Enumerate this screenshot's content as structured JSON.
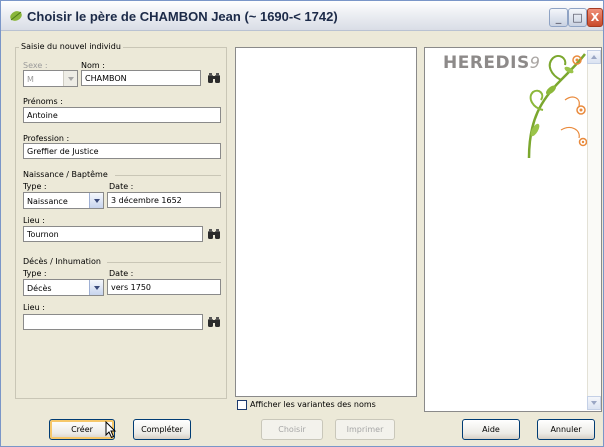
{
  "window": {
    "title": "Choisir le père de CHAMBON Jean (~ 1690-< 1742)",
    "minimize_glyph": "_",
    "maximize_glyph": "□",
    "close_glyph": "X"
  },
  "form": {
    "group_title": "Saisie du nouvel individu",
    "sexe_label": "Sexe :",
    "sexe_value": "M",
    "nom_label": "Nom :",
    "nom_value": "CHAMBON",
    "prenoms_label": "Prénoms :",
    "prenoms_value": "Antoine",
    "profession_label": "Profession :",
    "profession_value": "Greffier de Justice",
    "naissance": {
      "section_title": "Naissance / Baptême",
      "type_label": "Type :",
      "type_value": "Naissance",
      "date_label": "Date :",
      "date_value": "3 décembre 1652",
      "lieu_label": "Lieu :",
      "lieu_value": "Tournon"
    },
    "deces": {
      "section_title": "Décès / Inhumation",
      "type_label": "Type :",
      "type_value": "Décès",
      "date_label": "Date :",
      "date_value": "vers 1750",
      "lieu_label": "Lieu :",
      "lieu_value": ""
    }
  },
  "middle": {
    "checkbox_label": "Afficher les variantes des noms",
    "checkbox_checked": false
  },
  "brand": {
    "logo_text": "HEREDIS",
    "logo_num": "9",
    "accent_green": "#7ba72e",
    "accent_orange": "#e98a3c"
  },
  "buttons": {
    "creer": "Créer",
    "completer": "Compléter",
    "choisir": "Choisir",
    "imprimer": "Imprimer",
    "aide": "Aide",
    "annuler": "Annuler"
  },
  "icons": {
    "app": "heredis-leaf-icon",
    "search": "binoculars-icon"
  }
}
